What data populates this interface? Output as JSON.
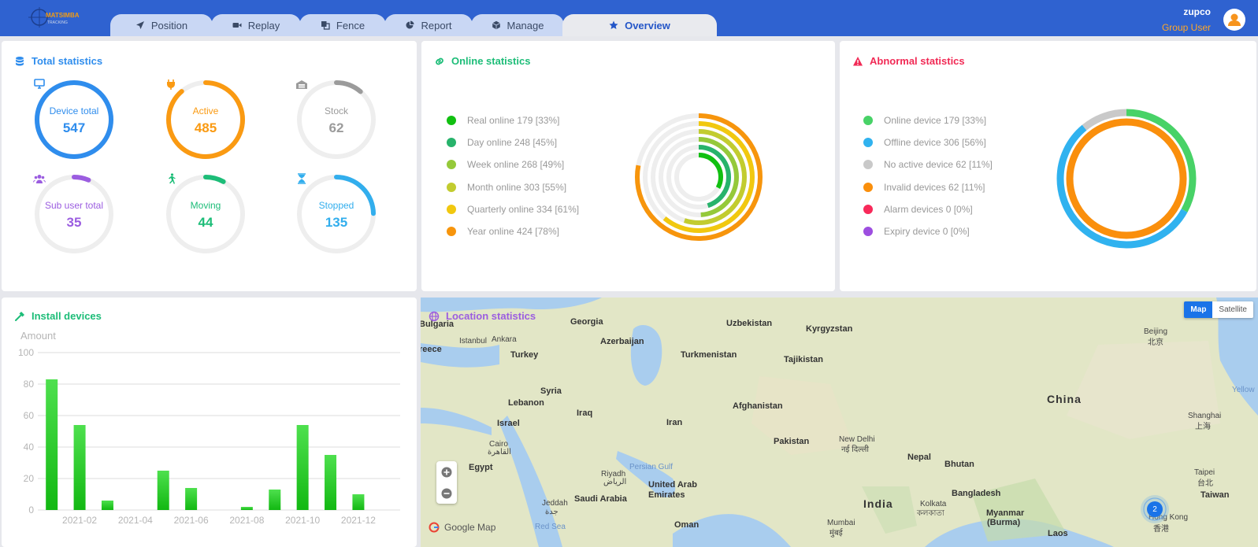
{
  "header": {
    "logo_text": "MATSIMBA",
    "logo_subtext": "TRACKING",
    "tabs": [
      {
        "label": "Position",
        "icon": "paper-plane-icon"
      },
      {
        "label": "Replay",
        "icon": "video-camera-icon"
      },
      {
        "label": "Fence",
        "icon": "copy-icon"
      },
      {
        "label": "Report",
        "icon": "pie-chart-icon"
      },
      {
        "label": "Manage",
        "icon": "cube-icon"
      },
      {
        "label": "Overview",
        "icon": "star-icon",
        "active": true
      }
    ],
    "user_name": "zupco",
    "user_role": "Group User",
    "colors": {
      "bar": "#2f62d0",
      "role": "#ffa726"
    }
  },
  "total": {
    "title": "Total statistics",
    "items": [
      {
        "label": "Device total",
        "value": "547",
        "color": "#2f8ded",
        "fraction": 1,
        "icon": "monitor-icon"
      },
      {
        "label": "Active",
        "value": "485",
        "color": "#fa9a12",
        "fraction": 0.887,
        "icon": "plug-icon"
      },
      {
        "label": "Stock",
        "value": "62",
        "color": "#9b9b9b",
        "fraction": 0.113,
        "icon": "warehouse-icon"
      },
      {
        "label": "Sub user total",
        "value": "35",
        "color": "#9b5de0",
        "fraction": 0.064,
        "icon": "users-icon"
      },
      {
        "label": "Moving",
        "value": "44",
        "color": "#1dbd78",
        "fraction": 0.08,
        "icon": "running-icon"
      },
      {
        "label": "Stopped",
        "value": "135",
        "color": "#32aeed",
        "fraction": 0.247,
        "icon": "hourglass-icon"
      }
    ]
  },
  "online": {
    "title": "Online statistics",
    "items": [
      {
        "label": "Real online 179 [33%]",
        "color": "#11c011",
        "percent": 33
      },
      {
        "label": "Day online 248 [45%]",
        "color": "#27b36b",
        "percent": 45
      },
      {
        "label": "Week online 268 [49%]",
        "color": "#95c93a",
        "percent": 49
      },
      {
        "label": "Month online 303 [55%]",
        "color": "#c2cc2f",
        "percent": 55
      },
      {
        "label": "Quarterly online 334 [61%]",
        "color": "#f1c80f",
        "percent": 61
      },
      {
        "label": "Year online 424 [78%]",
        "color": "#f7950c",
        "percent": 78
      }
    ]
  },
  "abnormal": {
    "title": "Abnormal statistics",
    "items": [
      {
        "label": "Online device 179 [33%]",
        "color": "#48d267"
      },
      {
        "label": "Offline device 306 [56%]",
        "color": "#30b2ef"
      },
      {
        "label": "No active device 62 [11%]",
        "color": "#c9c9c9"
      },
      {
        "label": "Invalid devices 62 [11%]",
        "color": "#fa8f0c"
      },
      {
        "label": "Alarm devices 0 [0%]",
        "color": "#f8295a"
      },
      {
        "label": "Expiry device 0 [0%]",
        "color": "#9d4ee0"
      }
    ],
    "outer_fractions": [
      0.33,
      0.56,
      0.11
    ],
    "inner_fraction": 1
  },
  "install": {
    "title": "Install devices",
    "chart_data": {
      "type": "bar",
      "ylabel": "Amount",
      "ylim": [
        0,
        100
      ],
      "yticks": [
        "0",
        "20",
        "40",
        "60",
        "80",
        "100"
      ],
      "categories": [
        "2021-01",
        "2021-02",
        "2021-03",
        "2021-04",
        "2021-05",
        "2021-06",
        "2021-07",
        "2021-08",
        "2021-09",
        "2021-10",
        "2021-11",
        "2021-12",
        "2022-01"
      ],
      "xtick_labels": [
        "2021-02",
        "2021-04",
        "2021-06",
        "2021-08",
        "2021-10",
        "2021-12"
      ],
      "values": [
        83,
        54,
        6,
        0,
        25,
        14,
        0,
        2,
        13,
        54,
        35,
        10,
        0
      ],
      "color": "#22c322"
    }
  },
  "location": {
    "title": "Location statistics",
    "map_type_buttons": [
      "Map",
      "Satellite"
    ],
    "google_label": "Google Map",
    "cluster_count": "2",
    "labels": [
      {
        "text": "Bulgaria",
        "cls": ""
      },
      {
        "text": "Georgia",
        "cls": ""
      },
      {
        "text": "Uzbekistan",
        "cls": ""
      },
      {
        "text": "Kyrgyzstan",
        "cls": ""
      },
      {
        "text": "Istanbul",
        "cls": "c"
      },
      {
        "text": "Ankara",
        "cls": "c"
      },
      {
        "text": "Azerbaijan",
        "cls": ""
      },
      {
        "text": "reece",
        "cls": ""
      },
      {
        "text": "Turkey",
        "cls": ""
      },
      {
        "text": "Turkmenistan",
        "cls": ""
      },
      {
        "text": "Tajikistan",
        "cls": ""
      },
      {
        "text": "Beijing",
        "cls": "c"
      },
      {
        "text": "北京",
        "cls": "c"
      },
      {
        "text": "Syria",
        "cls": ""
      },
      {
        "text": "Lebanon",
        "cls": ""
      },
      {
        "text": "Iraq",
        "cls": ""
      },
      {
        "text": "Afghanistan",
        "cls": ""
      },
      {
        "text": "China",
        "cls": "big"
      },
      {
        "text": "Yellow",
        "cls": "sea"
      },
      {
        "text": "Israel",
        "cls": ""
      },
      {
        "text": "Iran",
        "cls": ""
      },
      {
        "text": "Shanghai",
        "cls": "c"
      },
      {
        "text": "上海",
        "cls": "c"
      },
      {
        "text": "Cairo",
        "cls": "c"
      },
      {
        "text": "القاهرة",
        "cls": "c"
      },
      {
        "text": "Pakistan",
        "cls": ""
      },
      {
        "text": "New Delhi",
        "cls": "c"
      },
      {
        "text": "नई दिल्ली",
        "cls": "c"
      },
      {
        "text": "Egypt",
        "cls": ""
      },
      {
        "text": "Persian Gulf",
        "cls": "sea"
      },
      {
        "text": "Nepal",
        "cls": ""
      },
      {
        "text": "Bhutan",
        "cls": ""
      },
      {
        "text": "Riyadh",
        "cls": "c"
      },
      {
        "text": "الرياض",
        "cls": "c"
      },
      {
        "text": "United Arab",
        "cls": ""
      },
      {
        "text": "Emirates",
        "cls": ""
      },
      {
        "text": "Taipei",
        "cls": "c"
      },
      {
        "text": "台北",
        "cls": "c"
      },
      {
        "text": "Saudi Arabia",
        "cls": ""
      },
      {
        "text": "Bangladesh",
        "cls": ""
      },
      {
        "text": "Taiwan",
        "cls": ""
      },
      {
        "text": "Jeddah",
        "cls": "c"
      },
      {
        "text": "جدة",
        "cls": "c"
      },
      {
        "text": "India",
        "cls": "big"
      },
      {
        "text": "Kolkata",
        "cls": "c"
      },
      {
        "text": "কলকাতা",
        "cls": "c"
      },
      {
        "text": "Myanmar",
        "cls": ""
      },
      {
        "text": "(Burma)",
        "cls": ""
      },
      {
        "text": "Red Sea",
        "cls": "sea"
      },
      {
        "text": "Oman",
        "cls": ""
      },
      {
        "text": "Mumbai",
        "cls": "c"
      },
      {
        "text": "मुंबई",
        "cls": "c"
      },
      {
        "text": "Hong Kong",
        "cls": "c"
      },
      {
        "text": "香港",
        "cls": "c"
      },
      {
        "text": "Laos",
        "cls": ""
      }
    ]
  }
}
